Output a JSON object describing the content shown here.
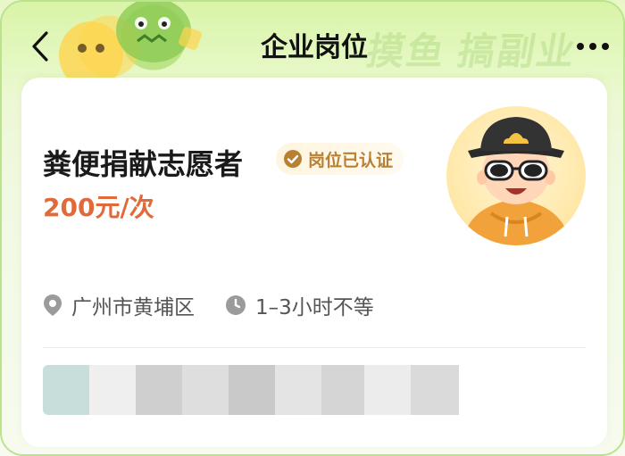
{
  "header": {
    "title": "企业岗位",
    "background_text": "摸鱼 搞副业",
    "back_icon": "chevron-left-icon",
    "more_icon": "more-dots-icon"
  },
  "job": {
    "title": "粪便捐献志愿者",
    "badge": "岗位已认证",
    "price": "200元/次",
    "location": "广州市黄埔区",
    "duration": "1–3小时不等"
  },
  "colors": {
    "accent_green": "#b9e48b",
    "price_orange": "#e06a3a",
    "badge_gold": "#b78033",
    "avatar_bg": "#ffe7a6"
  }
}
